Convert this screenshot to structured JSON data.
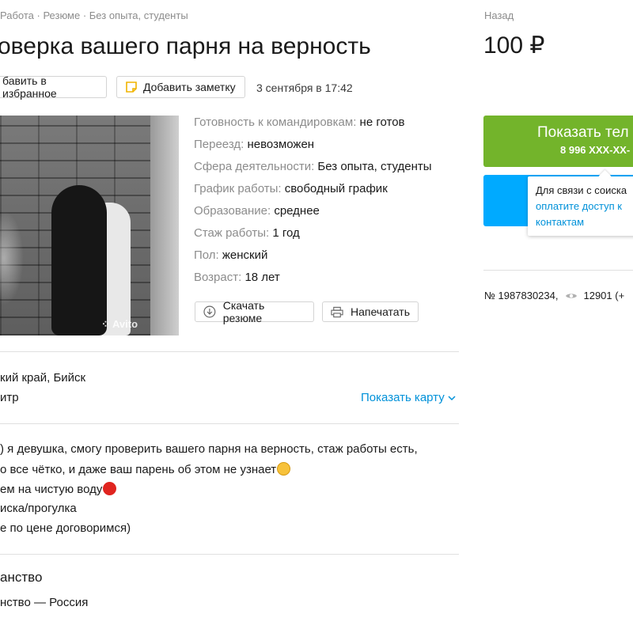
{
  "breadcrumbs": "Работа · Резюме · Без опыта, студенты",
  "title": "оверка вашего парня на верность",
  "actions": {
    "favorite": "бавить в избранное",
    "note": "Добавить заметку",
    "date": "3 сентября в 17:42"
  },
  "photo": {
    "watermark": "Avito"
  },
  "params": [
    {
      "key": "Готовность к командировкам:",
      "value": "не готов"
    },
    {
      "key": "Переезд:",
      "value": "невозможен"
    },
    {
      "key": "Сфера деятельности:",
      "value": "Без опыта, студенты"
    },
    {
      "key": "График работы:",
      "value": "свободный график"
    },
    {
      "key": "Образование:",
      "value": "среднее"
    },
    {
      "key": "Стаж работы:",
      "value": "1 год"
    },
    {
      "key": "Пол:",
      "value": "женский"
    },
    {
      "key": "Возраст:",
      "value": "18 лет"
    }
  ],
  "resume_buttons": {
    "download": "Скачать резюме",
    "print": "Напечатать"
  },
  "location": {
    "region": "кий край, Бийск",
    "district": "итр",
    "show_map": "Показать карту"
  },
  "description": [
    ") я девушка, смогу проверить вашего парня на верность, стаж работы есть,",
    "о все чётко, и даже ваш парень об этом не узнает",
    "ем на чистую воду",
    "иска/прогулка",
    "е по цене договоримся)"
  ],
  "citizenship": {
    "title": "анство",
    "value": "нство — Россия"
  },
  "sidebar": {
    "back": "Назад",
    "price": "100 ₽",
    "phone_button": {
      "label": "Показать тел",
      "number": "8 996 XXX-XX-"
    },
    "tooltip": {
      "text": "Для связи с соиска",
      "link": "оплатите доступ к контактам"
    },
    "ad_number": "№ 1987830234,",
    "views": "12901 (+"
  },
  "colors": {
    "green": "#73b42b",
    "blue": "#00aaff",
    "link": "#0091d9",
    "muted": "#8c8c8c"
  }
}
